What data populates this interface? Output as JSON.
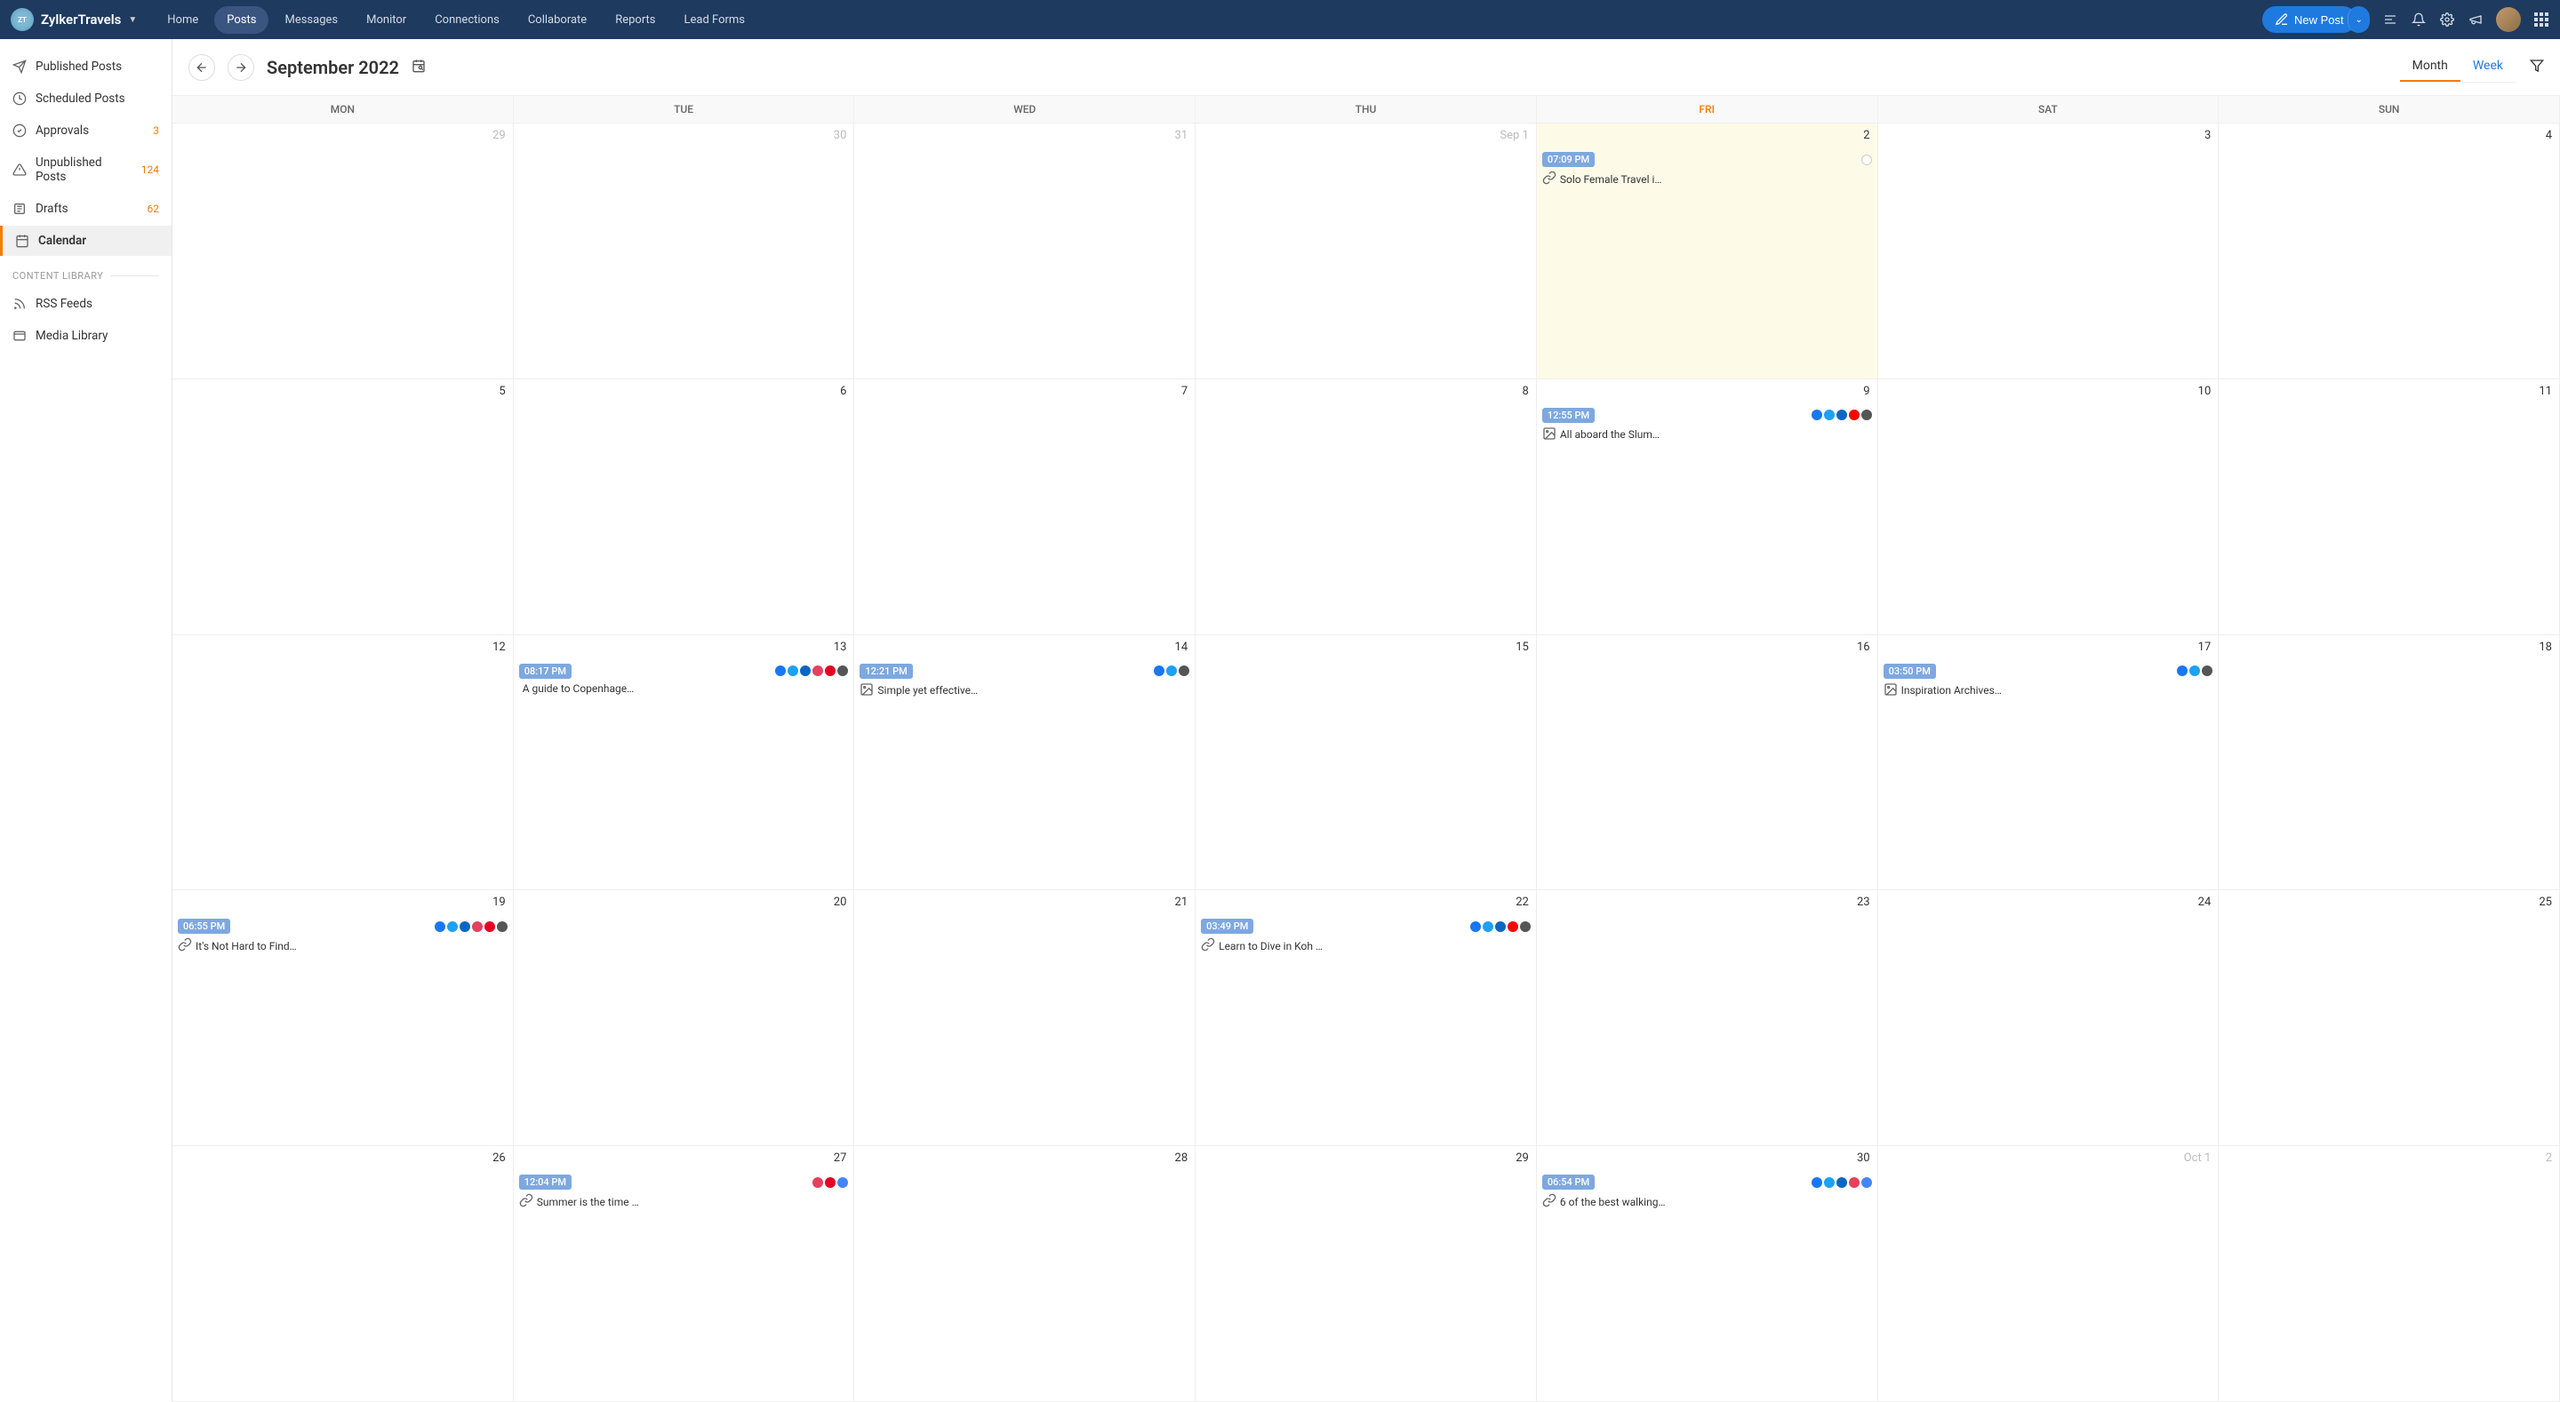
{
  "brand": {
    "name": "ZylkerTravels"
  },
  "nav": [
    "Home",
    "Posts",
    "Messages",
    "Monitor",
    "Connections",
    "Collaborate",
    "Reports",
    "Lead Forms"
  ],
  "nav_active": "Posts",
  "new_post": "New Post",
  "sidebar": {
    "items": [
      {
        "label": "Published Posts",
        "icon": "send",
        "badge": null
      },
      {
        "label": "Scheduled Posts",
        "icon": "clock",
        "badge": null
      },
      {
        "label": "Approvals",
        "icon": "check",
        "badge": "3"
      },
      {
        "label": "Unpublished Posts",
        "icon": "alert",
        "badge": "124"
      },
      {
        "label": "Drafts",
        "icon": "draft",
        "badge": "62"
      },
      {
        "label": "Calendar",
        "icon": "calendar",
        "badge": null
      }
    ],
    "active": "Calendar",
    "section": "CONTENT LIBRARY",
    "library": [
      {
        "label": "RSS Feeds",
        "icon": "rss"
      },
      {
        "label": "Media Library",
        "icon": "media"
      }
    ]
  },
  "toolbar": {
    "title": "September 2022",
    "tabs": [
      "Month",
      "Week"
    ],
    "active_tab": "Month"
  },
  "calendar": {
    "days": [
      "MON",
      "TUE",
      "WED",
      "THU",
      "FRI",
      "SAT",
      "SUN"
    ],
    "today_col": 4,
    "weeks": [
      [
        {
          "date": "29",
          "muted": true
        },
        {
          "date": "30",
          "muted": true
        },
        {
          "date": "31",
          "muted": true
        },
        {
          "date": "Sep 1",
          "label": true
        },
        {
          "date": "2",
          "today": true,
          "event": {
            "time": "07:09 PM",
            "title": "Solo Female Travel i…",
            "icon": "link",
            "networks": [
              "gmb"
            ]
          }
        },
        {
          "date": "3"
        },
        {
          "date": "4"
        }
      ],
      [
        {
          "date": "5"
        },
        {
          "date": "6"
        },
        {
          "date": "7"
        },
        {
          "date": "8"
        },
        {
          "date": "9",
          "event": {
            "time": "12:55 PM",
            "title": "All aboard the Slum…",
            "icon": "image",
            "networks": [
              "fb",
              "tw",
              "li",
              "yt",
              "tk"
            ]
          }
        },
        {
          "date": "10"
        },
        {
          "date": "11"
        }
      ],
      [
        {
          "date": "12"
        },
        {
          "date": "13",
          "event": {
            "time": "08:17 PM",
            "title": "A guide to Copenhage…",
            "icon": "none",
            "networks": [
              "fb",
              "tw",
              "li",
              "ig",
              "pn",
              "tk"
            ]
          }
        },
        {
          "date": "14",
          "event": {
            "time": "12:21 PM",
            "title": "Simple yet effective…",
            "icon": "image",
            "networks": [
              "fb",
              "tw",
              "tk"
            ]
          }
        },
        {
          "date": "15"
        },
        {
          "date": "16"
        },
        {
          "date": "17",
          "event": {
            "time": "03:50 PM",
            "title": "Inspiration Archives…",
            "icon": "image",
            "networks": [
              "fb",
              "tw",
              "tk"
            ]
          }
        },
        {
          "date": "18"
        }
      ],
      [
        {
          "date": "19",
          "event": {
            "time": "06:55 PM",
            "title": "It's Not Hard to Find…",
            "icon": "link",
            "networks": [
              "fb",
              "tw",
              "li",
              "ig",
              "pn",
              "tk"
            ]
          }
        },
        {
          "date": "20"
        },
        {
          "date": "21"
        },
        {
          "date": "22",
          "event": {
            "time": "03:49 PM",
            "title": "Learn to Dive in Koh …",
            "icon": "link",
            "networks": [
              "fb",
              "tw",
              "li",
              "yt",
              "tk"
            ]
          }
        },
        {
          "date": "23"
        },
        {
          "date": "24"
        },
        {
          "date": "25"
        }
      ],
      [
        {
          "date": "26"
        },
        {
          "date": "27",
          "event": {
            "time": "12:04 PM",
            "title": "Summer is the time …",
            "icon": "link",
            "networks": [
              "ig",
              "pn",
              "gb"
            ]
          }
        },
        {
          "date": "28"
        },
        {
          "date": "29"
        },
        {
          "date": "30",
          "event": {
            "time": "06:54 PM",
            "title": "6 of the best walking…",
            "icon": "link",
            "networks": [
              "fb",
              "tw",
              "li",
              "ig",
              "gb"
            ]
          }
        },
        {
          "date": "Oct 1",
          "label": true
        },
        {
          "date": "2",
          "muted": true
        }
      ]
    ]
  }
}
